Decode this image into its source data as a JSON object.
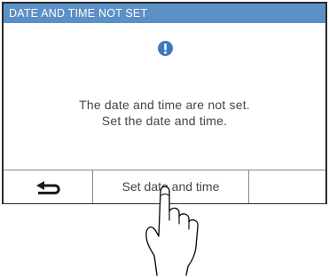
{
  "dialog": {
    "title": "DATE AND TIME NOT SET",
    "icon": "exclamation-icon",
    "message_line1": "The date and time are not set.",
    "message_line2": "Set the date and time."
  },
  "buttons": {
    "back_icon": "return-arrow-icon",
    "set_label": "Set date and time"
  },
  "colors": {
    "title_bar": "#5b90c6",
    "icon": "#3f79bd",
    "text": "#444444"
  }
}
